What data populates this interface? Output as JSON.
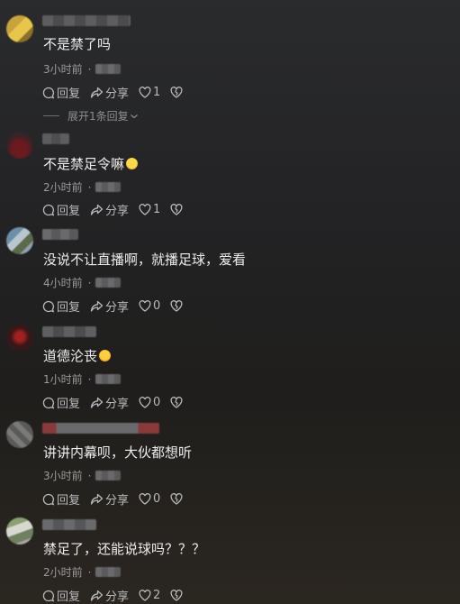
{
  "comments": [
    {
      "text": "不是禁了吗",
      "time": "3小时前",
      "dot": "·",
      "reply": "回复",
      "share": "分享",
      "likes": "1"
    },
    {
      "text": "不是禁足令嘛",
      "time": "2小时前",
      "dot": "·",
      "reply": "回复",
      "share": "分享",
      "likes": "1"
    },
    {
      "text": "没说不让直播啊，就播足球，爱看",
      "time": "4小时前",
      "dot": "·",
      "reply": "回复",
      "share": "分享",
      "likes": "0"
    },
    {
      "text": "道德沦丧",
      "time": "1小时前",
      "dot": "·",
      "reply": "回复",
      "share": "分享",
      "likes": "0"
    },
    {
      "text": "讲讲内幕呗，大伙都想听",
      "time": "3小时前",
      "dot": "·",
      "reply": "回复",
      "share": "分享",
      "likes": "0"
    },
    {
      "text": "禁足了，还能说球吗？？？",
      "time": "2小时前",
      "dot": "·",
      "reply": "回复",
      "share": "分享",
      "likes": "2"
    }
  ],
  "expand_replies": "展开1条回复"
}
